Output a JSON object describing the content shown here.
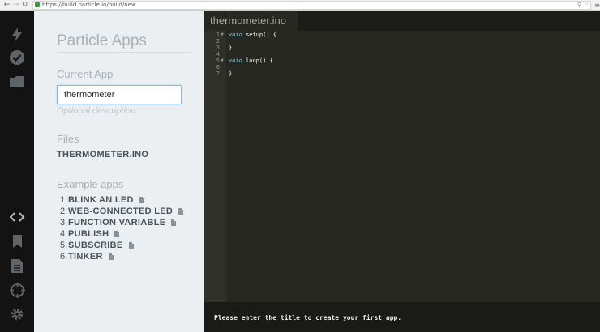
{
  "browser": {
    "url": "https://build.particle.io/build/new",
    "nav_back_icon": "back-arrow-icon",
    "nav_forward_icon": "forward-arrow-icon",
    "reload_icon": "reload-icon"
  },
  "rail": {
    "icons": [
      "flash-icon",
      "verify-icon",
      "folder-icon",
      "code-icon",
      "libraries-icon",
      "docs-icon",
      "devices-icon",
      "settings-icon"
    ]
  },
  "panel": {
    "title": "Particle Apps",
    "current_app_label": "Current App",
    "app_name_value": "thermometer",
    "description_placeholder": "Optional description",
    "files_label": "Files",
    "file_name": "THERMOMETER.INO",
    "examples_label": "Example apps",
    "examples": [
      {
        "num": "1.",
        "name": "BLINK AN LED"
      },
      {
        "num": "2.",
        "name": "WEB-CONNECTED LED"
      },
      {
        "num": "3.",
        "name": "FUNCTION VARIABLE"
      },
      {
        "num": "4.",
        "name": "PUBLISH"
      },
      {
        "num": "5.",
        "name": "SUBSCRIBE"
      },
      {
        "num": "6.",
        "name": "TINKER"
      }
    ]
  },
  "editor": {
    "tab_name": "thermometer.ino",
    "line_numbers": [
      "1",
      "2",
      "3",
      "4",
      "5",
      "6",
      "7"
    ],
    "code": {
      "l1_kw": "void",
      "l1_rest": " setup() {",
      "l3": "}",
      "l5_kw": "void",
      "l5_rest": " loop() {",
      "l7": "}"
    },
    "status_message": "Please enter the title to create your first app."
  },
  "colors": {
    "rail_bg": "#131313",
    "panel_bg": "#ebeff2",
    "editor_bg": "#272822",
    "keyword": "#66d9ef"
  }
}
